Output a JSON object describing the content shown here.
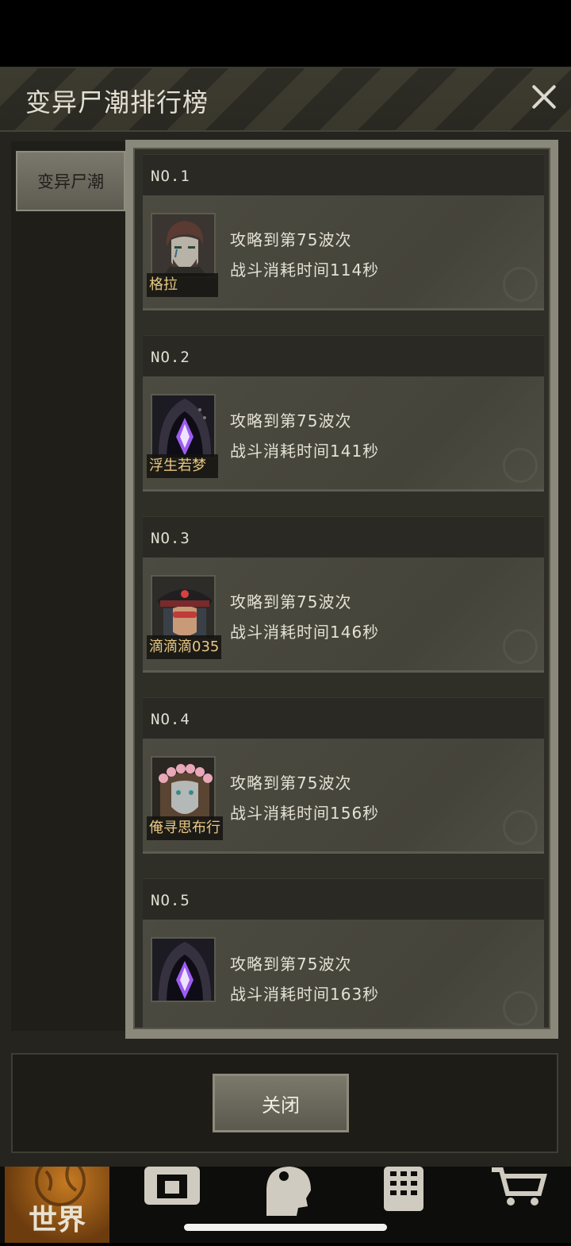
{
  "header": {
    "title": "变异尸潮排行榜"
  },
  "sidebar": {
    "tabs": [
      {
        "label": "变异尸潮"
      }
    ]
  },
  "rankings": [
    {
      "rank": "NO.1",
      "name": "格拉",
      "wave": "攻略到第75波次",
      "time": "战斗消耗时间114秒",
      "avatar": "bearded-man-portrait"
    },
    {
      "rank": "NO.2",
      "name": "浮生若梦",
      "wave": "攻略到第75波次",
      "time": "战斗消耗时间141秒",
      "avatar": "hooded-purple-crystal-portrait"
    },
    {
      "rank": "NO.3",
      "name": "滴滴滴035",
      "wave": "攻略到第75波次",
      "time": "战斗消耗时间146秒",
      "avatar": "officer-cap-portrait"
    },
    {
      "rank": "NO.4",
      "name": "俺寻思布行",
      "wave": "攻略到第75波次",
      "time": "战斗消耗时间156秒",
      "avatar": "flower-crown-portrait"
    },
    {
      "rank": "NO.5",
      "name": "",
      "wave": "攻略到第75波次",
      "time": "战斗消耗时间163秒",
      "avatar": "hooded-purple-crystal-portrait"
    }
  ],
  "footer": {
    "close_label": "关闭"
  },
  "bottom_nav": {
    "world_label": "世界",
    "icons": [
      "world-icon",
      "backpack-icon",
      "character-head-icon",
      "phone-icon",
      "shopping-cart-icon"
    ]
  },
  "colors": {
    "accent": "#e8c883",
    "panel": "#25241e",
    "card": "#4c4b41",
    "world_tab": "#c77b22"
  }
}
